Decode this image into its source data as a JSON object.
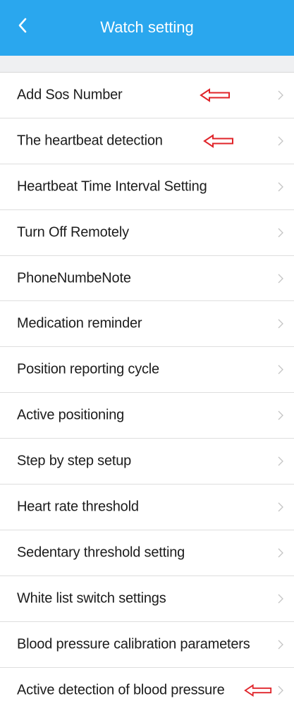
{
  "header": {
    "title": "Watch setting",
    "background_color": "#2aa7ee",
    "back_icon": "chevron-left-icon"
  },
  "settings": {
    "items": [
      {
        "label": "Add Sos Number",
        "annotated": true
      },
      {
        "label": "The heartbeat detection",
        "annotated": true
      },
      {
        "label": "Heartbeat Time Interval Setting",
        "annotated": false
      },
      {
        "label": "Turn Off Remotely",
        "annotated": false
      },
      {
        "label": "PhoneNumbeNote",
        "annotated": false
      },
      {
        "label": "Medication reminder",
        "annotated": false
      },
      {
        "label": "Position reporting cycle",
        "annotated": false
      },
      {
        "label": "Active positioning",
        "annotated": false
      },
      {
        "label": "Step by step setup",
        "annotated": false
      },
      {
        "label": "Heart rate threshold",
        "annotated": false
      },
      {
        "label": "Sedentary threshold setting",
        "annotated": false
      },
      {
        "label": "White list switch settings",
        "annotated": false
      },
      {
        "label": "Blood pressure calibration parameters",
        "annotated": false
      },
      {
        "label": "Active detection of blood pressure",
        "annotated": true
      }
    ],
    "row_icon": "chevron-right-icon",
    "annotation_icon": "red-arrow-left-icon",
    "annotation_color": "#e0242a"
  }
}
